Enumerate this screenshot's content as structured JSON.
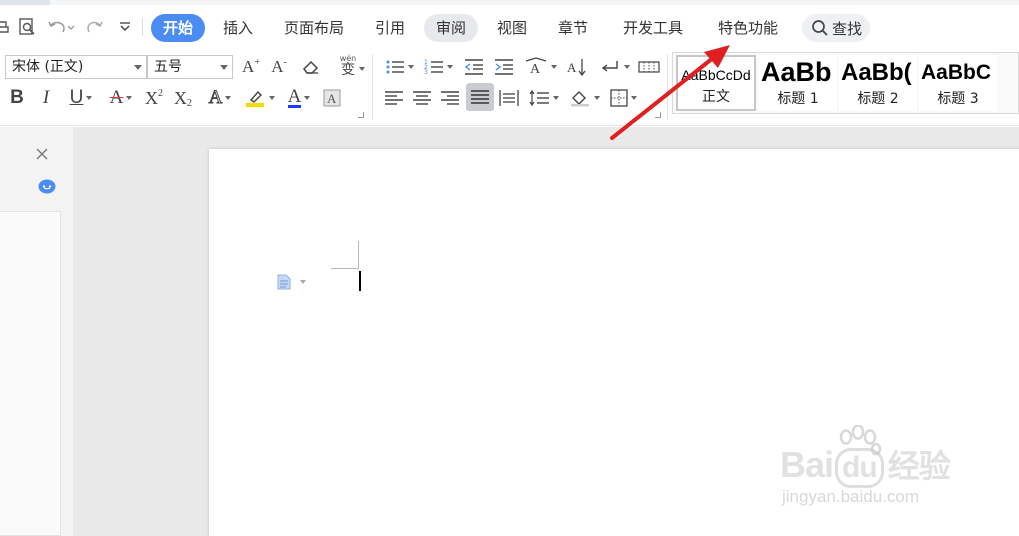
{
  "window": {
    "tabs": [
      {
        "id": "home",
        "label": "开始",
        "active": true
      },
      {
        "id": "insert",
        "label": "插入"
      },
      {
        "id": "layout",
        "label": "页面布局"
      },
      {
        "id": "references",
        "label": "引用"
      },
      {
        "id": "review",
        "label": "审阅"
      },
      {
        "id": "view",
        "label": "视图"
      },
      {
        "id": "chapter",
        "label": "章节"
      },
      {
        "id": "developer",
        "label": "开发工具"
      },
      {
        "id": "features",
        "label": "特色功能"
      }
    ],
    "search_label": "查找"
  },
  "ribbon": {
    "font_name": "宋体 (正文)",
    "font_size": "五号",
    "phonetic_label": "wén",
    "phonetic_char": "变",
    "bold": "B",
    "italic": "I",
    "underline": "U",
    "strike": "A",
    "superscript": "X",
    "superscript_mark": "2",
    "subscript": "X",
    "subscript_mark": "2",
    "text_effect": "A",
    "font_color": "A",
    "grow_font": "A",
    "shrink_font": "A",
    "styles": [
      {
        "sample": "AaBbCcDd",
        "name": "正文",
        "selected": true
      },
      {
        "sample": "AaBb",
        "name": "标题 1"
      },
      {
        "sample": "AaBb(",
        "name": "标题 2"
      },
      {
        "sample": "AaBbC",
        "name": "标题 3"
      }
    ]
  },
  "watermark": {
    "main_text": "Bai",
    "mid_text": "du",
    "cn_text": "经验",
    "sub_text": "jingyan.baidu.com"
  },
  "colors": {
    "accent": "#4a8cf2",
    "annotation_arrow": "#e02020",
    "highlight_yellow": "#f5d800",
    "font_color_red": "#e03030",
    "font_color_blue": "#1a3cff"
  }
}
